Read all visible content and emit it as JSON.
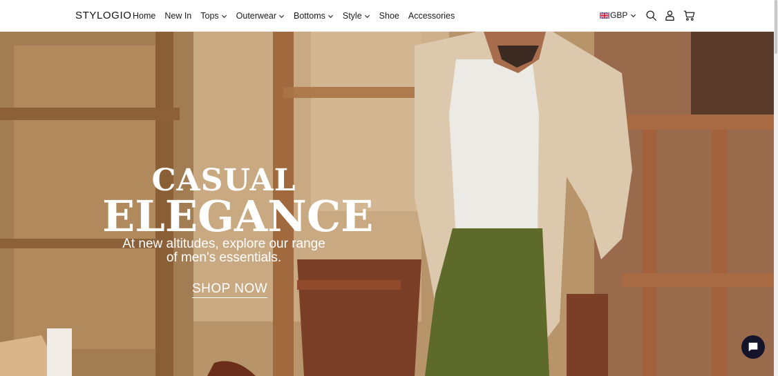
{
  "header": {
    "logo": "STYLOGIO",
    "nav": [
      {
        "label": "Home",
        "has_dropdown": false
      },
      {
        "label": "New In",
        "has_dropdown": false
      },
      {
        "label": "Tops",
        "has_dropdown": true
      },
      {
        "label": "Outerwear",
        "has_dropdown": true
      },
      {
        "label": "Bottoms",
        "has_dropdown": true
      },
      {
        "label": "Style",
        "has_dropdown": true
      },
      {
        "label": "Shoe",
        "has_dropdown": false
      },
      {
        "label": "Accessories",
        "has_dropdown": false
      }
    ],
    "currency": "GBP",
    "icons": [
      "search-icon",
      "user-icon",
      "cart-icon"
    ]
  },
  "hero": {
    "title_line1": "CASUAL",
    "title_line2": "ELEGANCE",
    "subtitle_line1": "At new altitudes, explore our range",
    "subtitle_line2": "of men's essentials.",
    "cta": "SHOP NOW"
  },
  "chat": {
    "icon": "chat-icon",
    "color": "#14142b"
  }
}
